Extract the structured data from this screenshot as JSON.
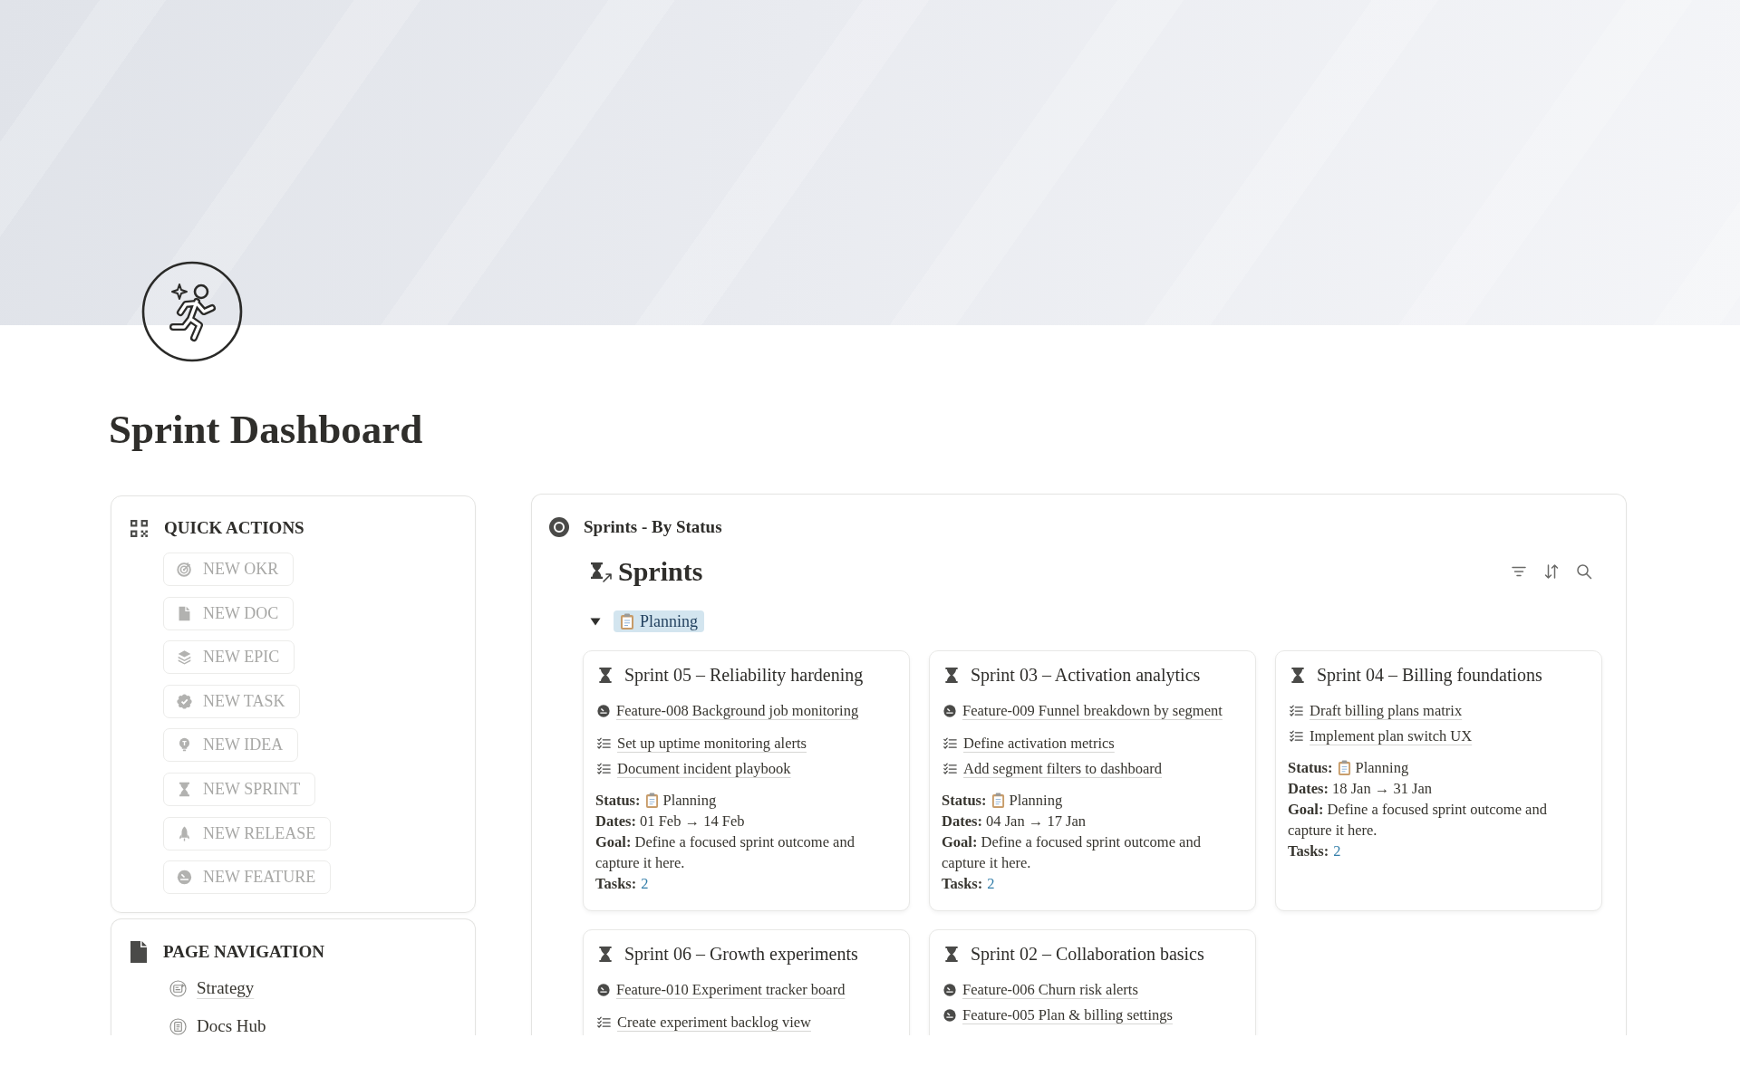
{
  "page": {
    "title": "Sprint Dashboard"
  },
  "quick_actions": {
    "title": "QUICK ACTIONS",
    "buttons": [
      {
        "label": "NEW OKR",
        "kind": "okr"
      },
      {
        "label": "NEW DOC",
        "kind": "doc"
      },
      {
        "label": "NEW EPIC",
        "kind": "epic"
      },
      {
        "label": "NEW TASK",
        "kind": "task"
      },
      {
        "label": "NEW IDEA",
        "kind": "idea"
      },
      {
        "label": "NEW SPRINT",
        "kind": "sprint"
      },
      {
        "label": "NEW RELEASE",
        "kind": "release"
      },
      {
        "label": "NEW FEATURE",
        "kind": "feature"
      }
    ]
  },
  "page_navigation": {
    "title": "PAGE NAVIGATION",
    "items": [
      {
        "label": "Strategy",
        "kind": "strategy"
      },
      {
        "label": "Docs Hub",
        "kind": "docs"
      }
    ]
  },
  "sprints_view": {
    "title": "Sprints - By Status",
    "database": {
      "title": "Sprints"
    },
    "groups": [
      {
        "label": "Planning",
        "expanded": true,
        "cards": [
          {
            "title": "Sprint 05 – Reliability hardening",
            "features": [
              "Feature-008 Background job monitoring"
            ],
            "tasks": [
              "Set up uptime monitoring alerts",
              "Document incident playbook"
            ],
            "properties": [
              {
                "kind": "status",
                "label": "Status:",
                "value": "Planning"
              },
              {
                "kind": "text",
                "label": "Dates:",
                "value": "01 Feb → 14 Feb"
              },
              {
                "kind": "text",
                "label": "Goal:",
                "value": "Define a focused sprint outcome and capture it here."
              },
              {
                "kind": "count",
                "label": "Tasks:",
                "value": "2"
              }
            ]
          },
          {
            "title": "Sprint 03 – Activation analytics",
            "features": [
              "Feature-009 Funnel breakdown by segment"
            ],
            "tasks": [
              "Define activation metrics",
              "Add segment filters to dashboard"
            ],
            "properties": [
              {
                "kind": "status",
                "label": "Status:",
                "value": "Planning"
              },
              {
                "kind": "text",
                "label": "Dates:",
                "value": "04 Jan → 17 Jan"
              },
              {
                "kind": "text",
                "label": "Goal:",
                "value": "Define a focused sprint outcome and capture it here."
              },
              {
                "kind": "count",
                "label": "Tasks:",
                "value": "2"
              }
            ]
          },
          {
            "title": "Sprint 04 – Billing foundations",
            "tasks": [
              "Draft billing plans matrix",
              "Implement plan switch UX"
            ],
            "properties": [
              {
                "kind": "status",
                "label": "Status:",
                "value": "Planning"
              },
              {
                "kind": "text",
                "label": "Dates:",
                "value": "18 Jan → 31 Jan"
              },
              {
                "kind": "text",
                "label": "Goal:",
                "value": "Define a focused sprint outcome and capture it here."
              },
              {
                "kind": "count",
                "label": "Tasks:",
                "value": "2"
              }
            ]
          },
          {
            "title": "Sprint 06 – Growth experiments",
            "features": [
              "Feature-010 Experiment tracker board"
            ],
            "tasks": [
              "Create experiment backlog view"
            ]
          },
          {
            "title": "Sprint 02 – Collaboration basics",
            "features": [
              "Feature-006 Churn risk alerts",
              "Feature-005 Plan & billing settings"
            ]
          }
        ]
      }
    ]
  }
}
